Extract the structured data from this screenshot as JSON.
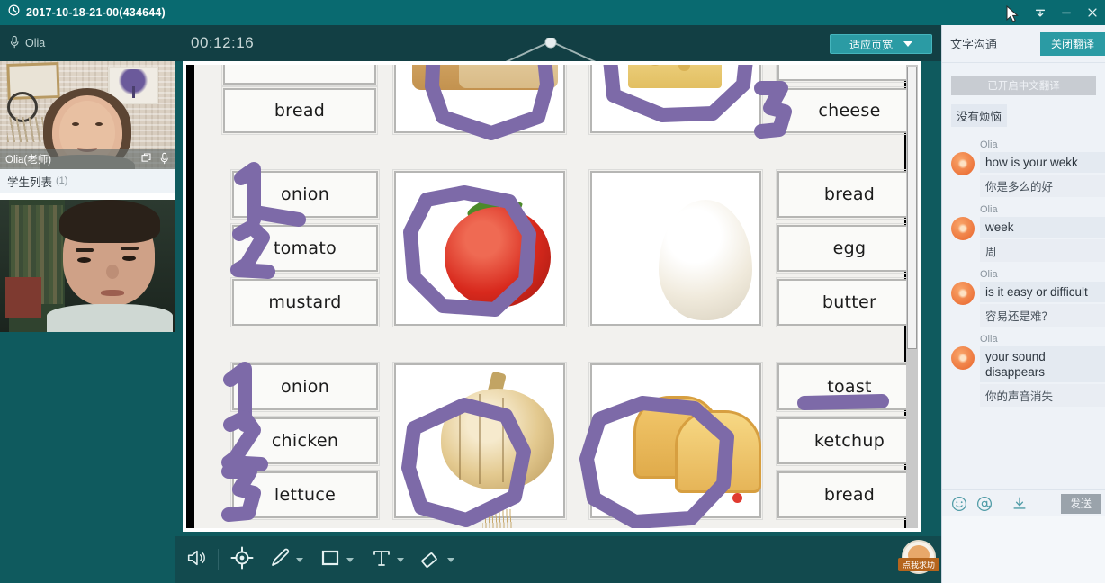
{
  "titlebar": {
    "clock_icon": "clock-icon",
    "title": "2017-10-18-21-00(434644)",
    "restore_icon": "chevron-down-icon",
    "minimize_icon": "minimize-icon",
    "close_icon": "close-icon"
  },
  "subbar": {
    "mic_icon": "microphone-icon",
    "speaker_name": "Olia",
    "timer": "00:12:16",
    "fit_button": "适应页宽"
  },
  "sidebar": {
    "teacher": {
      "name": "Olia(老师)",
      "window_icon": "window-icon",
      "mic_icon": "microphone-icon"
    },
    "student_list_label": "学生列表",
    "student_list_count": "(1)"
  },
  "whiteboard": {
    "worksheet_rows": [
      {
        "left_words": [
          "",
          "bread"
        ],
        "left_marks": [
          "",
          ""
        ],
        "images": [
          "bread-image",
          "cheese-image"
        ],
        "right_words": [
          "",
          "cheese"
        ],
        "right_marks": [
          "",
          "3"
        ]
      },
      {
        "left_words": [
          "onion",
          "tomato",
          "mustard"
        ],
        "left_marks": [
          "1",
          "2",
          ""
        ],
        "images": [
          "tomato-image",
          "egg-image"
        ],
        "right_words": [
          "bread",
          "egg",
          "butter"
        ],
        "right_marks": [
          "",
          "",
          ""
        ]
      },
      {
        "left_words": [
          "onion",
          "chicken",
          "lettuce"
        ],
        "left_marks": [
          "1",
          "2",
          "3"
        ],
        "images": [
          "onion-image",
          "toast-image"
        ],
        "right_words": [
          "toast",
          "ketchup",
          "bread"
        ],
        "right_marks": [
          "",
          "",
          ""
        ]
      }
    ],
    "annotation_color": "#7d6aa8",
    "red_dot_color": "#e03a2f"
  },
  "toolbar": {
    "items": [
      {
        "icon": "speaker-icon",
        "has_dropdown": false
      },
      {
        "icon": "target-icon",
        "has_dropdown": false
      },
      {
        "icon": "pencil-icon",
        "has_dropdown": true
      },
      {
        "icon": "rectangle-icon",
        "has_dropdown": true
      },
      {
        "icon": "text-icon",
        "has_dropdown": true
      },
      {
        "icon": "eraser-icon",
        "has_dropdown": true
      }
    ],
    "mascot_label": "点我求助"
  },
  "chat": {
    "title": "文字沟通",
    "close_translate_button": "关闭翻译",
    "system_banner": "已开启中文翻译",
    "first_message_cn": "没有烦恼",
    "messages": [
      {
        "name": "Olia",
        "en": "how is your wekk",
        "cn": "你是多么的好"
      },
      {
        "name": "Olia",
        "en": "week",
        "cn": "周"
      },
      {
        "name": "Olia",
        "en": "is it easy or difficult",
        "cn": "容易还是难？"
      },
      {
        "name": "Olia",
        "en": "your sound disappears",
        "cn": "你的声音消失"
      }
    ],
    "emoji_icon": "smiley-icon",
    "mention_icon": "at-icon",
    "download_icon": "download-icon",
    "send_button": "发送"
  },
  "colors": {
    "titlebar": "#096a70",
    "subbar": "#123f44",
    "accent": "#2b9ba4",
    "chat_bg": "#eef2f7"
  }
}
